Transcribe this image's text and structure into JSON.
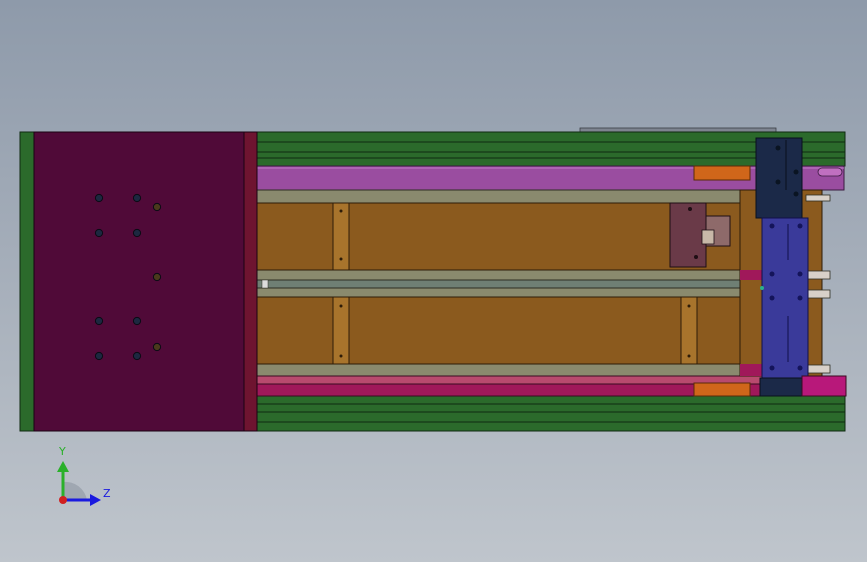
{
  "viewport": {
    "background_top": "#8e9aaa",
    "background_bottom": "#bfc5cc"
  },
  "colors": {
    "frame_green": "#2b6a2b",
    "frame_green_dark": "#0f2a10",
    "end_plate": "#500a38",
    "end_plate_edge": "#6e1430",
    "violet_rail": "#9a4da0",
    "rail_grey": "#8a8a6e",
    "wood_panel": "#8b5a1e",
    "carriage_navy": "#1b2948",
    "carriage_blue": "#3a3a9a",
    "orange_stop": "#d0661a",
    "crimson_rail": "#a0185a",
    "block_mauve": "#6a3a48",
    "axis_x": "#1a1adf",
    "axis_y": "#2ab02a",
    "axis_origin": "#d02020"
  },
  "triad": {
    "y_label": "Y",
    "z_label": "Z",
    "icon": "coordinate-triad-icon"
  }
}
